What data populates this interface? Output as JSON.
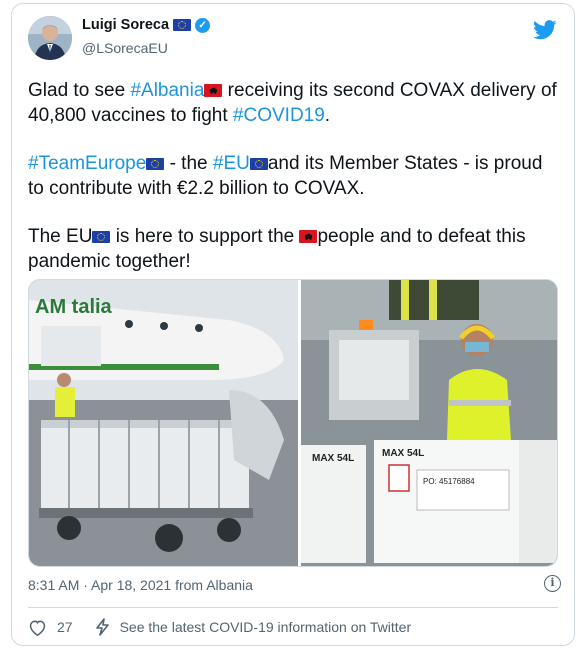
{
  "author": {
    "name": "Luigi Soreca",
    "handle": "@LSorecaEU",
    "verified": true
  },
  "tweet": {
    "line1_pre": "Glad to see ",
    "hashtag_albania": "#Albania",
    "line1_post": " receiving its second COVAX delivery of 40,800 vaccines to fight ",
    "hashtag_covid": "#COVID19",
    "line1_end": ".",
    "hashtag_teameurope": "#TeamEurope",
    "p2_mid": " - the ",
    "hashtag_eu": "#EU",
    "p2_post": "and its Member States - is proud to contribute with €2.2 billion to COVAX.",
    "p3_pre": "The EU",
    "p3_mid": " is here to support the ",
    "p3_post": "people and to defeat this pandemic together!"
  },
  "media": {
    "left_plane_text": "AM talia",
    "box_labels": [
      "MAX 54L",
      "MAX 54L",
      "PO: 45176884"
    ]
  },
  "meta": {
    "timestamp": "8:31 AM · Apr 18, 2021 from Albania"
  },
  "actions": {
    "like_count": "27",
    "covid_info": "See the latest COVID-19 information on Twitter"
  },
  "colors": {
    "accent": "#1b95e0",
    "verified": "#1d9bf0",
    "muted": "#536471",
    "border": "#cfd9de"
  },
  "icons": {
    "brand": "twitter-bird-icon",
    "verified": "verified-badge-icon",
    "info": "info-icon",
    "like": "heart-icon",
    "covid": "lightning-icon"
  }
}
